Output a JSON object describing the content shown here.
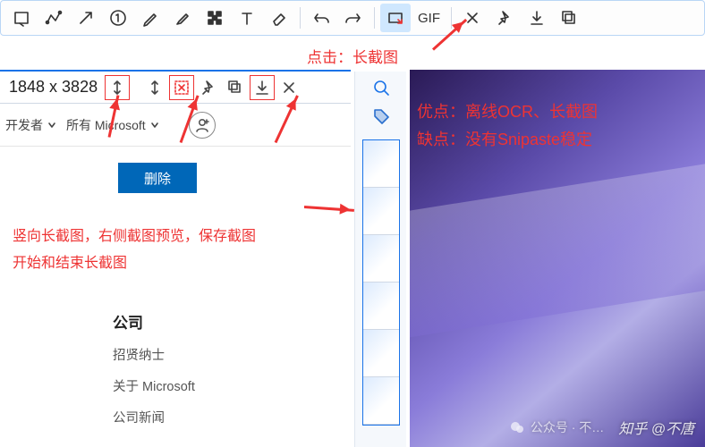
{
  "toolbar_top": {
    "tools": [
      {
        "name": "rect-select-icon"
      },
      {
        "name": "polyline-icon"
      },
      {
        "name": "arrow-icon"
      },
      {
        "name": "number-circle-icon"
      },
      {
        "name": "pencil-icon"
      },
      {
        "name": "highlighter-icon"
      },
      {
        "name": "mosaic-icon"
      },
      {
        "name": "text-icon"
      },
      {
        "name": "eraser-icon"
      }
    ],
    "tools_mid": [
      {
        "name": "undo-icon"
      },
      {
        "name": "redo-icon"
      }
    ],
    "tools_export": [
      {
        "name": "long-screenshot-icon",
        "selected": true
      },
      {
        "name": "gif-label",
        "text": "GIF"
      }
    ],
    "tools_end": [
      {
        "name": "close-icon"
      },
      {
        "name": "pin-icon"
      },
      {
        "name": "download-icon"
      },
      {
        "name": "copy-icon"
      }
    ]
  },
  "annot_top": "点击：长截图",
  "toolbar_sec": {
    "dimensions": "1848 x 3828",
    "buttons": [
      {
        "name": "scroll-vert-icon",
        "red": true,
        "boxed": true
      },
      {
        "name": "scroll-toggle-icon"
      },
      {
        "name": "crop-x-icon",
        "red": true,
        "boxed": true
      },
      {
        "name": "pin-icon"
      },
      {
        "name": "copy-icon"
      },
      {
        "name": "download-icon",
        "boxed": true
      },
      {
        "name": "close-icon"
      }
    ]
  },
  "browserbar": {
    "crumb1": "开发者",
    "crumb2": "所有 Microsoft"
  },
  "delete_btn": "删除",
  "annot_mid": {
    "line1": "竖向长截图，右侧截图预览，保存截图",
    "line2": "开始和结束长截图"
  },
  "company": {
    "title": "公司",
    "links": [
      "招贤纳士",
      "关于 Microsoft",
      "公司新闻"
    ]
  },
  "preview_tools": [
    {
      "name": "zoom-icon"
    },
    {
      "name": "tag-icon"
    }
  ],
  "review": {
    "pros_label": "优点：",
    "pros_text": "离线OCR、长截图",
    "cons_label": "缺点：",
    "cons_text": "没有Snipaste稳定"
  },
  "watermark": {
    "wechat": "公众号 · 不…",
    "zhihu": "知乎 @不唐"
  }
}
